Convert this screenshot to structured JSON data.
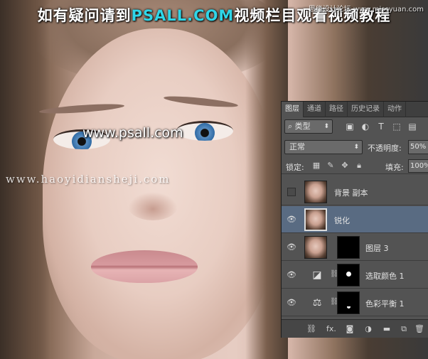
{
  "overlay": {
    "headline_prefix": "如有疑问请到",
    "headline_brand": "PSALL.COM",
    "headline_suffix": "视频栏目观看视频教程",
    "corner_watermark": "思缘设计论坛 www.missyuan.com",
    "site_url": "www.psall.com",
    "site_url_secondary": "www.haoyidiansheji.com"
  },
  "panel": {
    "tabs": [
      {
        "label": "图层",
        "active": true
      },
      {
        "label": "通道"
      },
      {
        "label": "路径"
      },
      {
        "label": "历史记录"
      },
      {
        "label": "动作"
      }
    ],
    "filter": {
      "kind_label": "类型",
      "icons": [
        "image-filter-icon",
        "adjustment-filter-icon",
        "type-filter-icon",
        "shape-filter-icon",
        "smart-object-filter-icon"
      ]
    },
    "blend_mode": "正常",
    "opacity_label": "不透明度:",
    "opacity_value": "50%",
    "lock_label": "锁定:",
    "fill_label": "填充:",
    "fill_value": "100%",
    "layers": [
      {
        "name": "背景 副本",
        "visible": false,
        "selected": false,
        "type": "pixel"
      },
      {
        "name": "锐化",
        "visible": true,
        "selected": true,
        "type": "pixel"
      },
      {
        "name": "图层 3",
        "visible": true,
        "selected": false,
        "type": "pixel-mask"
      },
      {
        "name": "选取颜色 1",
        "visible": true,
        "selected": false,
        "type": "adjustment",
        "icon": "selective-color-icon"
      },
      {
        "name": "色彩平衡 1",
        "visible": true,
        "selected": false,
        "type": "adjustment",
        "icon": "color-balance-icon"
      }
    ],
    "bottom_icons": [
      "link-layers-icon",
      "fx-icon",
      "add-mask-icon",
      "adjustment-layer-icon",
      "group-folder-icon",
      "new-layer-icon",
      "trash-icon"
    ]
  },
  "bottom_fx_label": "fx."
}
